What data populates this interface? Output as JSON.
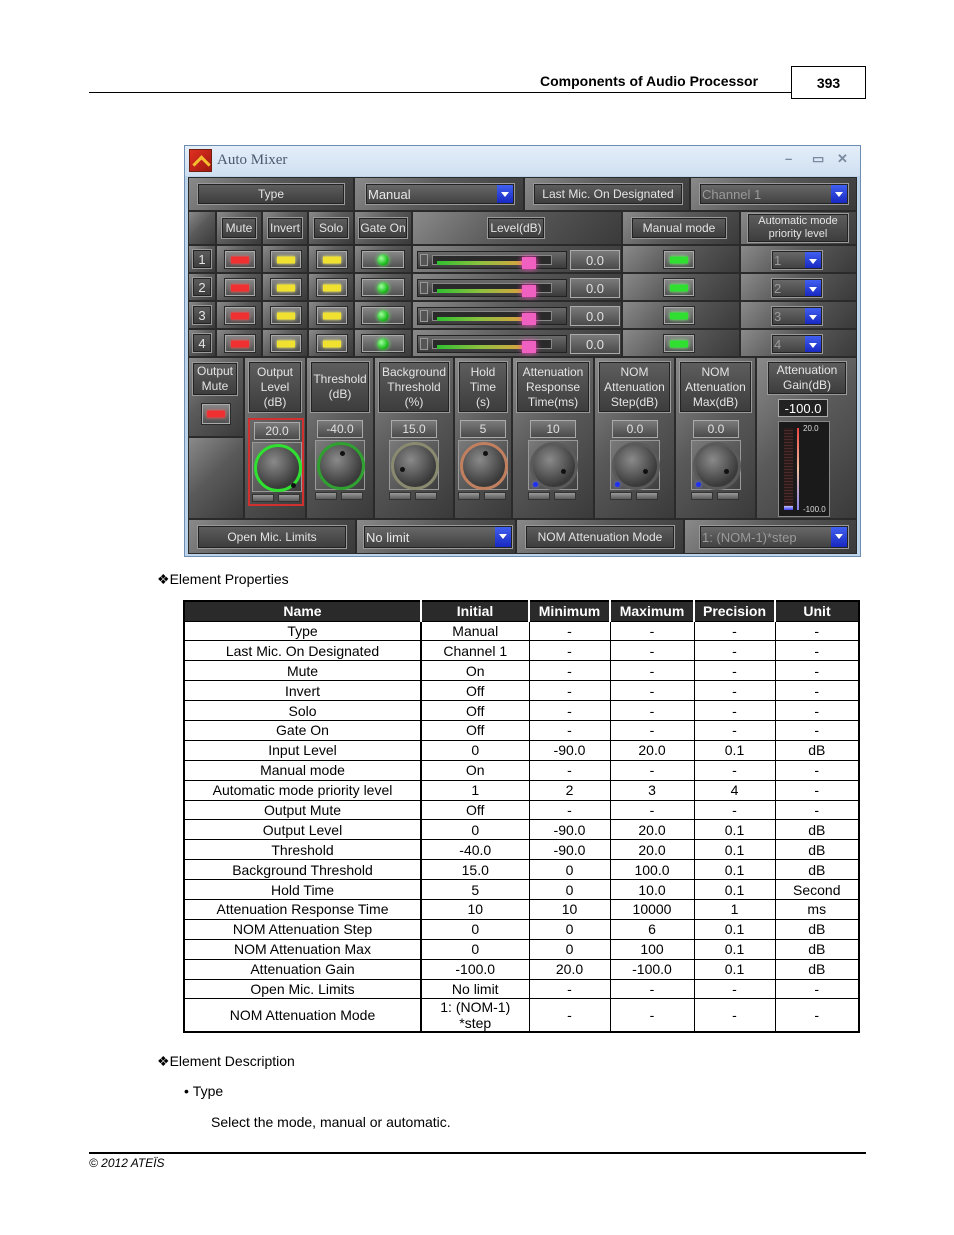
{
  "header": {
    "title": "Components of Audio Processor",
    "page_number": "393"
  },
  "window": {
    "title": "Auto Mixer",
    "controls": {
      "minimize": "–",
      "maximize": "▭",
      "close": "✕"
    },
    "top_row": {
      "type_label": "Type",
      "type_value": "Manual",
      "last_mic_label": "Last Mic. On Designated",
      "last_mic_value": "Channel 1"
    },
    "column_headers": {
      "mute": "Mute",
      "invert": "Invert",
      "solo": "Solo",
      "gate_on": "Gate On",
      "level": "Level(dB)",
      "manual_mode": "Manual mode",
      "auto_priority": "Automatic mode\npriority level"
    },
    "channels": [
      {
        "number": "1",
        "level_value": "0.0",
        "level_fraction": 0.82,
        "priority": "1"
      },
      {
        "number": "2",
        "level_value": "0.0",
        "level_fraction": 0.82,
        "priority": "2"
      },
      {
        "number": "3",
        "level_value": "0.0",
        "level_fraction": 0.82,
        "priority": "3"
      },
      {
        "number": "4",
        "level_value": "0.0",
        "level_fraction": 0.82,
        "priority": "4"
      }
    ],
    "output": {
      "output_mute_label": "Output\nMute",
      "knobs": [
        {
          "label": "Output\nLevel\n(dB)",
          "value": "20.0",
          "ring": "#30e030"
        },
        {
          "label": "Threshold\n(dB)",
          "value": "-40.0",
          "ring": "#30a030"
        },
        {
          "label": "Background\nThreshold\n(%)",
          "value": "15.0",
          "ring": "#8a8a70"
        },
        {
          "label": "Hold\nTime\n(s)",
          "value": "5",
          "ring": "#c08060"
        },
        {
          "label": "Attenuation\nResponse\nTime(ms)",
          "value": "10",
          "ring": "#5a5a5a"
        },
        {
          "label": "NOM\nAttenuation\nStep(dB)",
          "value": "0.0",
          "ring": "#5a5a5a"
        },
        {
          "label": "NOM\nAttenuation\nMax(dB)",
          "value": "0.0",
          "ring": "#5a5a5a"
        }
      ],
      "attenuation_gain": {
        "label": "Attenuation\nGain(dB)",
        "value": "-100.0",
        "scale_max": "20.0",
        "scale_min": "-100.0"
      }
    },
    "bottom_row": {
      "open_mic_label": "Open Mic. Limits",
      "open_mic_value": "No limit",
      "nom_mode_label": "NOM Attenuation Mode",
      "nom_mode_value": "1: (NOM-1)*step"
    }
  },
  "element_properties_heading": "Element Properties",
  "table": {
    "headers": [
      "Name",
      "Initial",
      "Minimum",
      "Maximum",
      "Precision",
      "Unit"
    ],
    "rows": [
      [
        "Type",
        "Manual",
        "-",
        "-",
        "-",
        "-"
      ],
      [
        "Last Mic. On Designated",
        "Channel 1",
        "-",
        "-",
        "-",
        "-"
      ],
      [
        "Mute",
        "On",
        "-",
        "-",
        "-",
        "-"
      ],
      [
        "Invert",
        "Off",
        "-",
        "-",
        "-",
        "-"
      ],
      [
        "Solo",
        "Off",
        "-",
        "-",
        "-",
        "-"
      ],
      [
        "Gate On",
        "Off",
        "-",
        "-",
        "-",
        "-"
      ],
      [
        "Input Level",
        "0",
        "-90.0",
        "20.0",
        "0.1",
        "dB"
      ],
      [
        "Manual mode",
        "On",
        "-",
        "-",
        "-",
        "-"
      ],
      [
        "Automatic mode priority level",
        "1",
        "2",
        "3",
        "4",
        "-"
      ],
      [
        "Output Mute",
        "Off",
        "-",
        "-",
        "-",
        "-"
      ],
      [
        "Output Level",
        "0",
        "-90.0",
        "20.0",
        "0.1",
        "dB"
      ],
      [
        "Threshold",
        "-40.0",
        "-90.0",
        "20.0",
        "0.1",
        "dB"
      ],
      [
        "Background Threshold",
        "15.0",
        "0",
        "100.0",
        "0.1",
        "dB"
      ],
      [
        "Hold Time",
        "5",
        "0",
        "10.0",
        "0.1",
        "Second"
      ],
      [
        "Attenuation Response Time",
        "10",
        "10",
        "10000",
        "1",
        "ms"
      ],
      [
        "NOM Attenuation Step",
        "0",
        "0",
        "6",
        "0.1",
        "dB"
      ],
      [
        "NOM Attenuation Max",
        "0",
        "0",
        "100",
        "0.1",
        "dB"
      ],
      [
        "Attenuation Gain",
        "-100.0",
        "20.0",
        "-100.0",
        "0.1",
        "dB"
      ],
      [
        "Open Mic. Limits",
        "No limit",
        "-",
        "-",
        "-",
        "-"
      ],
      [
        "NOM Attenuation Mode",
        "1: (NOM-1)\n*step",
        "-",
        "-",
        "-",
        "-"
      ]
    ]
  },
  "element_description_heading": "Element Description",
  "description": {
    "bullet": "Type",
    "text": "Select the mode, manual or automatic."
  },
  "footer": "© 2012 ATEÏS"
}
